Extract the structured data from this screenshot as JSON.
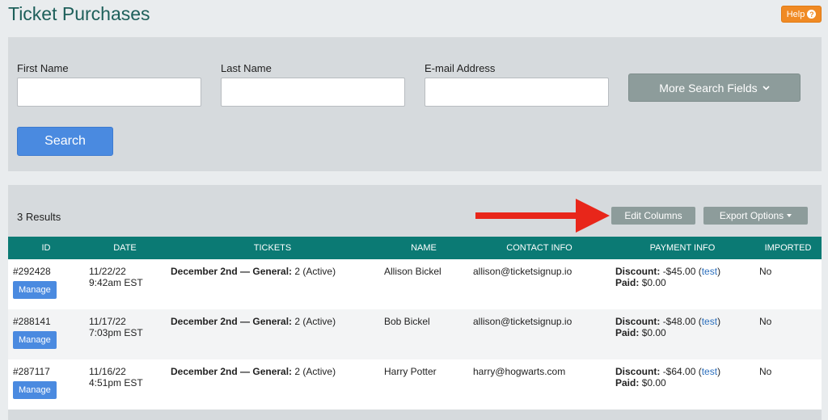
{
  "page": {
    "title": "Ticket Purchases",
    "help_label": "Help"
  },
  "search": {
    "first_name_label": "First Name",
    "last_name_label": "Last Name",
    "email_label": "E-mail Address",
    "first_name_value": "",
    "last_name_value": "",
    "email_value": "",
    "more_fields_label": "More Search Fields",
    "search_label": "Search"
  },
  "results": {
    "count_label": "3 Results",
    "edit_columns_label": "Edit Columns",
    "export_label": "Export Options",
    "columns": [
      "ID",
      "DATE",
      "TICKETS",
      "NAME",
      "CONTACT INFO",
      "PAYMENT INFO",
      "IMPORTED"
    ],
    "manage_label": "Manage",
    "rows": [
      {
        "id": "#292428",
        "date": "11/22/22",
        "time": "9:42am EST",
        "ticket_type": "December 2nd — General:",
        "ticket_qty": "2 (Active)",
        "name": "Allison Bickel",
        "contact": "allison@ticketsignup.io",
        "discount_label": "Discount:",
        "discount_value": "-$45.00 (",
        "discount_code": "test",
        "discount_close": ")",
        "paid_label": "Paid:",
        "paid_value": "$0.00",
        "imported": "No"
      },
      {
        "id": "#288141",
        "date": "11/17/22",
        "time": "7:03pm EST",
        "ticket_type": "December 2nd — General:",
        "ticket_qty": "2 (Active)",
        "name": "Bob Bickel",
        "contact": "allison@ticketsignup.io",
        "discount_label": "Discount:",
        "discount_value": "-$48.00 (",
        "discount_code": "test",
        "discount_close": ")",
        "paid_label": "Paid:",
        "paid_value": "$0.00",
        "imported": "No"
      },
      {
        "id": "#287117",
        "date": "11/16/22",
        "time": "4:51pm EST",
        "ticket_type": "December 2nd — General:",
        "ticket_qty": "2 (Active)",
        "name": "Harry Potter",
        "contact": "harry@hogwarts.com",
        "discount_label": "Discount:",
        "discount_value": "-$64.00 (",
        "discount_code": "test",
        "discount_close": ")",
        "paid_label": "Paid:",
        "paid_value": "$0.00",
        "imported": "No"
      }
    ]
  },
  "colors": {
    "title": "#1d5f5a",
    "header": "#0b7a74",
    "primary": "#4a8ae0",
    "secondary": "#8d9c9b",
    "help": "#f08a24",
    "arrow": "#e8261a"
  }
}
